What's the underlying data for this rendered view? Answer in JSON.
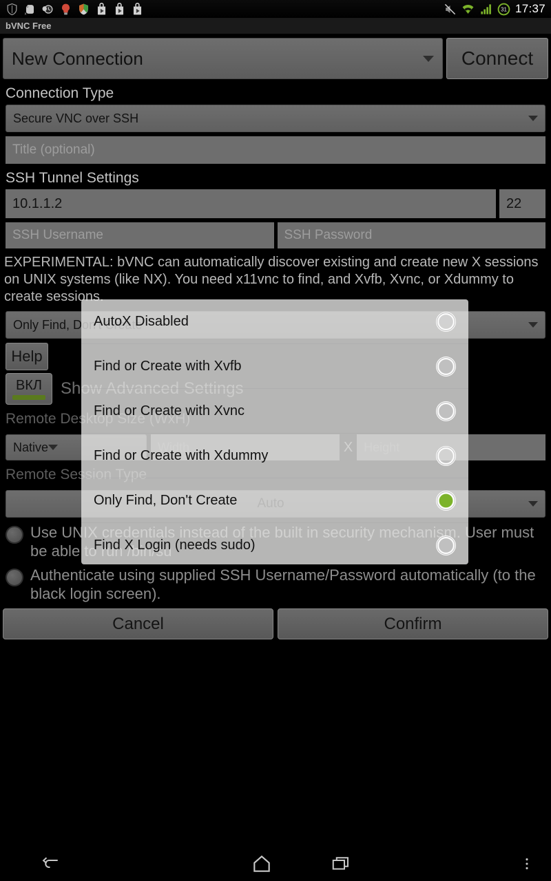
{
  "statusbar": {
    "left_icons": [
      "shield-icon",
      "evernote-icon",
      "clock-skull-icon",
      "lightbulb-icon",
      "security-shield-icon",
      "play-store-icon",
      "play-store-icon",
      "play-store-icon"
    ],
    "right_icons": [
      "mute-icon",
      "wifi-icon",
      "signal-icon"
    ],
    "battery_level": "31",
    "time": "17:37"
  },
  "titlebar": {
    "app_name": "bVNC Free"
  },
  "toolbar": {
    "connection_name": "New Connection",
    "connect_label": "Connect"
  },
  "form": {
    "connection_type_label": "Connection Type",
    "connection_type_value": "Secure VNC over SSH",
    "title_placeholder": "Title (optional)",
    "ssh_section_label": "SSH Tunnel Settings",
    "ssh_host": "10.1.1.2",
    "ssh_port": "22",
    "ssh_username_placeholder": "SSH Username",
    "ssh_password_placeholder": "SSH Password",
    "experimental_text": "EXPERIMENTAL: bVNC can automatically discover existing and create new X sessions on UNIX systems (like NX). You need x11vnc to find, and Xvfb, Xvnc, or Xdummy to create sessions.",
    "autox_value": "Only Find, Don't Create",
    "help_label": "Help",
    "toggle_label": "ВКЛ",
    "show_advanced_label": "Show Advanced Settings",
    "desktop_size_label": "Remote Desktop Size (WxH)",
    "desktop_size_value": "Native",
    "width_placeholder": "Width",
    "height_placeholder": "Height",
    "size_separator": "X",
    "session_type_label": "Remote Session Type",
    "session_type_value": "Auto",
    "checkbox_unix_label": "Use UNIX credentials instead of the built in security mechanism. User must be able to run /bin/su",
    "checkbox_auth_label": "Authenticate using supplied SSH Username/Password automatically (to the black login screen).",
    "cancel_label": "Cancel",
    "confirm_label": "Confirm"
  },
  "dialog": {
    "options": [
      {
        "label": "AutoX Disabled",
        "selected": false
      },
      {
        "label": "Find or Create with Xvfb",
        "selected": false
      },
      {
        "label": "Find or Create with Xvnc",
        "selected": false
      },
      {
        "label": "Find or Create with Xdummy",
        "selected": false
      },
      {
        "label": "Only Find, Don't Create",
        "selected": true
      },
      {
        "label": "Find X Login (needs sudo)",
        "selected": false
      }
    ]
  },
  "navbar": {
    "back": "back-icon",
    "home": "home-icon",
    "recents": "recents-icon",
    "menu": "overflow-menu-icon"
  },
  "colors": {
    "accent_green": "#7cb32a",
    "toggle_bar": "#5a7a1e",
    "background": "#000000",
    "field": "#6e6e6e"
  }
}
